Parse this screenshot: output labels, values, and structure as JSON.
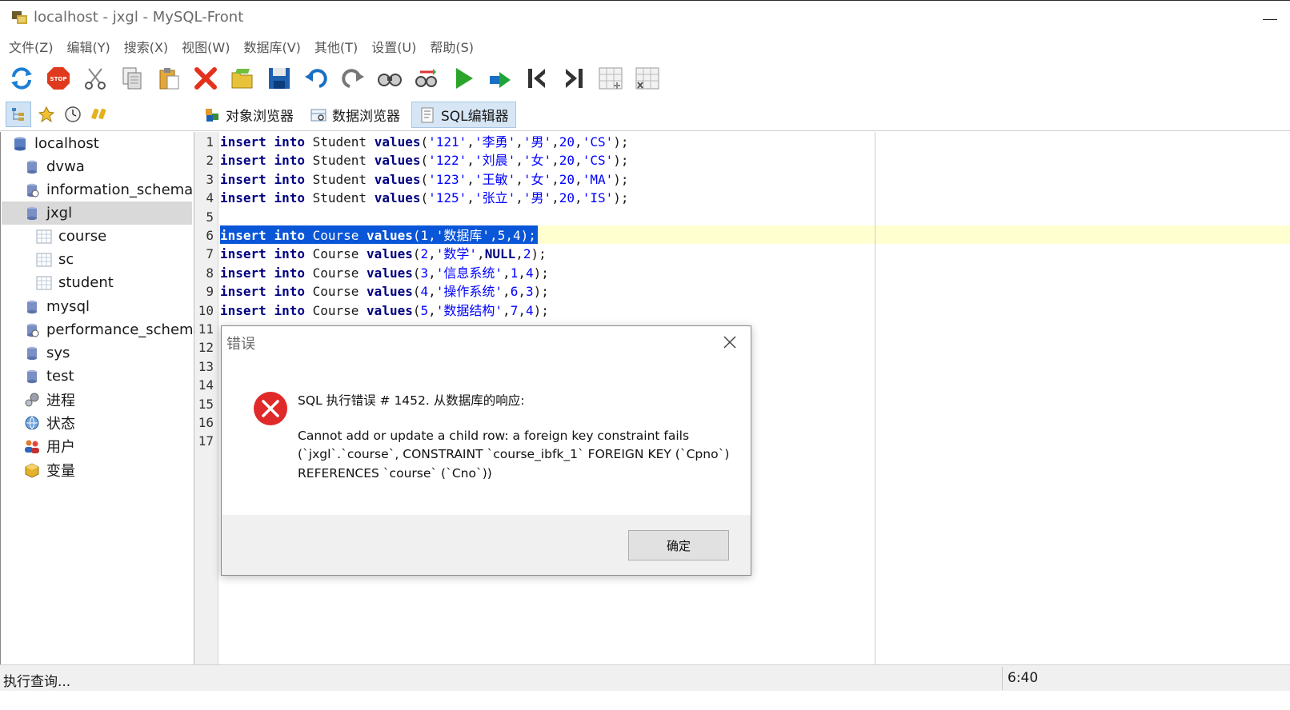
{
  "window": {
    "title": "localhost - jxgl - MySQL-Front"
  },
  "menu": [
    "文件(Z)",
    "编辑(Y)",
    "搜索(X)",
    "视图(W)",
    "数据库(V)",
    "其他(T)",
    "设置(U)",
    "帮助(S)"
  ],
  "toolbar": {
    "buttons": [
      "refresh-icon",
      "stop-icon",
      "cut-icon",
      "copy-icon",
      "paste-icon",
      "delete-icon",
      "open-icon",
      "save-icon",
      "undo-icon",
      "redo-icon",
      "find-icon",
      "replace-icon",
      "run-icon",
      "run-selection-icon",
      "first-record-icon",
      "last-record-icon",
      "insert-record-icon",
      "delete-record-icon"
    ]
  },
  "view_toggles": [
    "tree-view-icon",
    "favorites-icon",
    "history-icon",
    "sql-files-icon"
  ],
  "tabs": [
    {
      "label": "对象浏览器",
      "icon": "object-browser-icon",
      "active": false
    },
    {
      "label": "数据浏览器",
      "icon": "data-browser-icon",
      "active": false
    },
    {
      "label": "SQL编辑器",
      "icon": "sql-editor-icon",
      "active": true
    }
  ],
  "tree": [
    {
      "label": "localhost",
      "icon": "server-icon",
      "level": 0
    },
    {
      "label": "dvwa",
      "icon": "database-icon",
      "level": 1
    },
    {
      "label": "information_schema",
      "icon": "system-database-icon",
      "level": 1
    },
    {
      "label": "jxgl",
      "icon": "database-icon",
      "level": 1,
      "selected": true
    },
    {
      "label": "course",
      "icon": "table-icon",
      "level": 2
    },
    {
      "label": "sc",
      "icon": "table-icon",
      "level": 2
    },
    {
      "label": "student",
      "icon": "table-icon",
      "level": 2
    },
    {
      "label": "mysql",
      "icon": "database-icon",
      "level": 1
    },
    {
      "label": "performance_schema",
      "icon": "system-database-icon",
      "level": 1
    },
    {
      "label": "sys",
      "icon": "database-icon",
      "level": 1
    },
    {
      "label": "test",
      "icon": "database-icon",
      "level": 1
    },
    {
      "label": "进程",
      "icon": "processes-icon",
      "level": 1
    },
    {
      "label": "状态",
      "icon": "status-icon",
      "level": 1
    },
    {
      "label": "用户",
      "icon": "users-icon",
      "level": 1
    },
    {
      "label": "变量",
      "icon": "variables-icon",
      "level": 1
    }
  ],
  "editor": {
    "line_numbers": [
      "1",
      "2",
      "3",
      "4",
      "5",
      "6",
      "7",
      "8",
      "9",
      "10",
      "11",
      "12",
      "13",
      "14",
      "15",
      "16",
      "17"
    ],
    "selected_line": 6,
    "lines": [
      [
        [
          "kw",
          "insert"
        ],
        [
          "pun",
          " "
        ],
        [
          "kw",
          "into"
        ],
        [
          "pun",
          " "
        ],
        [
          "id",
          "Student"
        ],
        [
          "pun",
          " "
        ],
        [
          "kw",
          "values"
        ],
        [
          "pun",
          "("
        ],
        [
          "str",
          "'121'"
        ],
        [
          "pun",
          ","
        ],
        [
          "str",
          "'李勇'"
        ],
        [
          "pun",
          ","
        ],
        [
          "str",
          "'男'"
        ],
        [
          "pun",
          ","
        ],
        [
          "num",
          "20"
        ],
        [
          "pun",
          ","
        ],
        [
          "str",
          "'CS'"
        ],
        [
          "pun",
          ");"
        ]
      ],
      [
        [
          "kw",
          "insert"
        ],
        [
          "pun",
          " "
        ],
        [
          "kw",
          "into"
        ],
        [
          "pun",
          " "
        ],
        [
          "id",
          "Student"
        ],
        [
          "pun",
          " "
        ],
        [
          "kw",
          "values"
        ],
        [
          "pun",
          "("
        ],
        [
          "str",
          "'122'"
        ],
        [
          "pun",
          ","
        ],
        [
          "str",
          "'刘晨'"
        ],
        [
          "pun",
          ","
        ],
        [
          "str",
          "'女'"
        ],
        [
          "pun",
          ","
        ],
        [
          "num",
          "20"
        ],
        [
          "pun",
          ","
        ],
        [
          "str",
          "'CS'"
        ],
        [
          "pun",
          ");"
        ]
      ],
      [
        [
          "kw",
          "insert"
        ],
        [
          "pun",
          " "
        ],
        [
          "kw",
          "into"
        ],
        [
          "pun",
          " "
        ],
        [
          "id",
          "Student"
        ],
        [
          "pun",
          " "
        ],
        [
          "kw",
          "values"
        ],
        [
          "pun",
          "("
        ],
        [
          "str",
          "'123'"
        ],
        [
          "pun",
          ","
        ],
        [
          "str",
          "'王敏'"
        ],
        [
          "pun",
          ","
        ],
        [
          "str",
          "'女'"
        ],
        [
          "pun",
          ","
        ],
        [
          "num",
          "20"
        ],
        [
          "pun",
          ","
        ],
        [
          "str",
          "'MA'"
        ],
        [
          "pun",
          ");"
        ]
      ],
      [
        [
          "kw",
          "insert"
        ],
        [
          "pun",
          " "
        ],
        [
          "kw",
          "into"
        ],
        [
          "pun",
          " "
        ],
        [
          "id",
          "Student"
        ],
        [
          "pun",
          " "
        ],
        [
          "kw",
          "values"
        ],
        [
          "pun",
          "("
        ],
        [
          "str",
          "'125'"
        ],
        [
          "pun",
          ","
        ],
        [
          "str",
          "'张立'"
        ],
        [
          "pun",
          ","
        ],
        [
          "str",
          "'男'"
        ],
        [
          "pun",
          ","
        ],
        [
          "num",
          "20"
        ],
        [
          "pun",
          ","
        ],
        [
          "str",
          "'IS'"
        ],
        [
          "pun",
          ");"
        ]
      ],
      [],
      [
        [
          "kw",
          "insert"
        ],
        [
          "pun",
          " "
        ],
        [
          "kw",
          "into"
        ],
        [
          "pun",
          " "
        ],
        [
          "id",
          "Course"
        ],
        [
          "pun",
          " "
        ],
        [
          "kw",
          "values"
        ],
        [
          "pun",
          "("
        ],
        [
          "num",
          "1"
        ],
        [
          "pun",
          ","
        ],
        [
          "str",
          "'数据库'"
        ],
        [
          "pun",
          ","
        ],
        [
          "num",
          "5"
        ],
        [
          "pun",
          ","
        ],
        [
          "num",
          "4"
        ],
        [
          "pun",
          ");"
        ]
      ],
      [
        [
          "kw",
          "insert"
        ],
        [
          "pun",
          " "
        ],
        [
          "kw",
          "into"
        ],
        [
          "pun",
          " "
        ],
        [
          "id",
          "Course"
        ],
        [
          "pun",
          " "
        ],
        [
          "kw",
          "values"
        ],
        [
          "pun",
          "("
        ],
        [
          "num",
          "2"
        ],
        [
          "pun",
          ","
        ],
        [
          "str",
          "'数学'"
        ],
        [
          "pun",
          ","
        ],
        [
          "kw",
          "NULL"
        ],
        [
          "pun",
          ","
        ],
        [
          "num",
          "2"
        ],
        [
          "pun",
          ");"
        ]
      ],
      [
        [
          "kw",
          "insert"
        ],
        [
          "pun",
          " "
        ],
        [
          "kw",
          "into"
        ],
        [
          "pun",
          " "
        ],
        [
          "id",
          "Course"
        ],
        [
          "pun",
          " "
        ],
        [
          "kw",
          "values"
        ],
        [
          "pun",
          "("
        ],
        [
          "num",
          "3"
        ],
        [
          "pun",
          ","
        ],
        [
          "str",
          "'信息系统'"
        ],
        [
          "pun",
          ","
        ],
        [
          "num",
          "1"
        ],
        [
          "pun",
          ","
        ],
        [
          "num",
          "4"
        ],
        [
          "pun",
          ");"
        ]
      ],
      [
        [
          "kw",
          "insert"
        ],
        [
          "pun",
          " "
        ],
        [
          "kw",
          "into"
        ],
        [
          "pun",
          " "
        ],
        [
          "id",
          "Course"
        ],
        [
          "pun",
          " "
        ],
        [
          "kw",
          "values"
        ],
        [
          "pun",
          "("
        ],
        [
          "num",
          "4"
        ],
        [
          "pun",
          ","
        ],
        [
          "str",
          "'操作系统'"
        ],
        [
          "pun",
          ","
        ],
        [
          "num",
          "6"
        ],
        [
          "pun",
          ","
        ],
        [
          "num",
          "3"
        ],
        [
          "pun",
          ");"
        ]
      ],
      [
        [
          "kw",
          "insert"
        ],
        [
          "pun",
          " "
        ],
        [
          "kw",
          "into"
        ],
        [
          "pun",
          " "
        ],
        [
          "id",
          "Course"
        ],
        [
          "pun",
          " "
        ],
        [
          "kw",
          "values"
        ],
        [
          "pun",
          "("
        ],
        [
          "num",
          "5"
        ],
        [
          "pun",
          ","
        ],
        [
          "str",
          "'数据结构'"
        ],
        [
          "pun",
          ","
        ],
        [
          "num",
          "7"
        ],
        [
          "pun",
          ","
        ],
        [
          "num",
          "4"
        ],
        [
          "pun",
          ");"
        ]
      ]
    ]
  },
  "dialog": {
    "title": "错误",
    "heading": "SQL 执行错误 # 1452. 从数据库的响应:",
    "message_lines": [
      "Cannot add or update a child row: a foreign key constraint fails",
      "(`jxgl`.`course`, CONSTRAINT `course_ibfk_1` FOREIGN KEY (`Cpno`)",
      "REFERENCES `course` (`Cno`))"
    ],
    "ok_label": "确定"
  },
  "status": {
    "text": "执行查询...",
    "position": "6:40"
  },
  "colors": {
    "selection": "#0a56d8",
    "current_line": "#ffffd0",
    "keyword": "#000080",
    "string": "#0000ff",
    "error_icon": "#e02a2a"
  }
}
